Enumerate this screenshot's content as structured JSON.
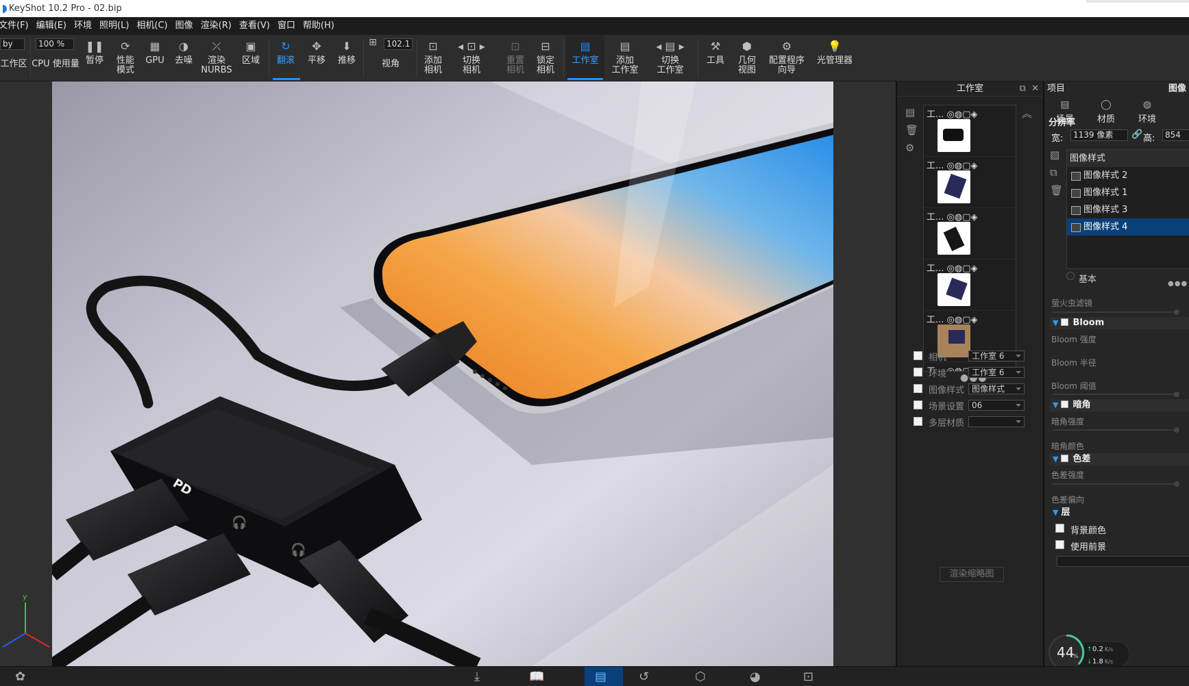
{
  "window": {
    "title": "KeyShot 10.2 Pro  -  02.bip"
  },
  "menu": [
    "文件(F)",
    "编辑(E)",
    "环境",
    "照明(L)",
    "相机(C)",
    "图像",
    "渲染(R)",
    "查看(V)",
    "窗口",
    "帮助(H)"
  ],
  "toolbar": {
    "workspace_value": "by",
    "workspace_label": "工作区",
    "cpu_value": "100 %",
    "cpu_label": "CPU 使用量",
    "pause": "暂停",
    "perf_mode": [
      "性能",
      "模式"
    ],
    "gpu": "GPU",
    "denoise": "去噪",
    "render_nurbs": [
      "渲染",
      "NURBS"
    ],
    "region": "区域",
    "tumble": "翻滚",
    "pan": "平移",
    "dolly": "推移",
    "view_value": "102.1",
    "view_label": "视角",
    "add_camera": [
      "添加",
      "相机"
    ],
    "switch_camera": [
      "切换",
      "相机"
    ],
    "reset_camera": [
      "重置",
      "相机"
    ],
    "lock_camera": [
      "锁定",
      "相机"
    ],
    "studio": "工作室",
    "add_studio": [
      "添加",
      "工作室"
    ],
    "switch_studio": [
      "切换",
      "工作室"
    ],
    "tools": "工具",
    "geometry_view": [
      "几何",
      "视图"
    ],
    "config_wizard": [
      "配置程序",
      "向导"
    ],
    "light_manager": "光管理器"
  },
  "render": {
    "adapter_labels": [
      "PD"
    ],
    "axis_y": "y"
  },
  "studio_panel": {
    "title": "工作室",
    "items": [
      {
        "label": "工..."
      },
      {
        "label": "工..."
      },
      {
        "label": "工..."
      },
      {
        "label": "工..."
      },
      {
        "label": "工..."
      },
      {
        "label": "工..."
      }
    ],
    "options": [
      {
        "label": "相机",
        "value": "工作室 6"
      },
      {
        "label": "环境",
        "value": "工作室 6"
      },
      {
        "label": "图像样式",
        "value": "图像样式"
      },
      {
        "label": "场景设置",
        "value": "06"
      },
      {
        "label": "多层材质",
        "value": ""
      }
    ],
    "render_thumbnail": "渲染缩略图"
  },
  "project_panel": {
    "title": "项目",
    "right_title": "图像",
    "tabs": [
      "场景",
      "材质",
      "环境"
    ],
    "resolution_label": "分辨率",
    "width_label": "宽:",
    "width_value": "1139 像素",
    "height_label": "高:",
    "height_value": "854",
    "image_styles_header": "图像样式",
    "image_styles": [
      "图像样式 2",
      "图像样式 1",
      "图像样式 3",
      "图像样式 4"
    ],
    "selected_style": "图像样式 4",
    "mode_basic": "基本",
    "firefly_filter": "萤火虫滤镜",
    "bloom": "Bloom",
    "bloom_strength": "Bloom 强度",
    "bloom_radius": "Bloom 半径",
    "bloom_threshold": "Bloom 阈值",
    "vignette": "暗角",
    "vignette_strength": "暗角强度",
    "vignette_color": "暗角颜色",
    "chromatic": "色差",
    "chromatic_strength": "色差强度",
    "chromatic_offset": "色差偏向",
    "layers": "层",
    "bg_color": "背景颜色",
    "use_foreground": "使用前景"
  },
  "net_widget": {
    "percent": "44",
    "percent_unit": "%",
    "up": "0.2",
    "down": "1.8",
    "unit": "K/s"
  },
  "colors": {
    "accent": "#1e90ff",
    "selected": "#0b3f78"
  }
}
